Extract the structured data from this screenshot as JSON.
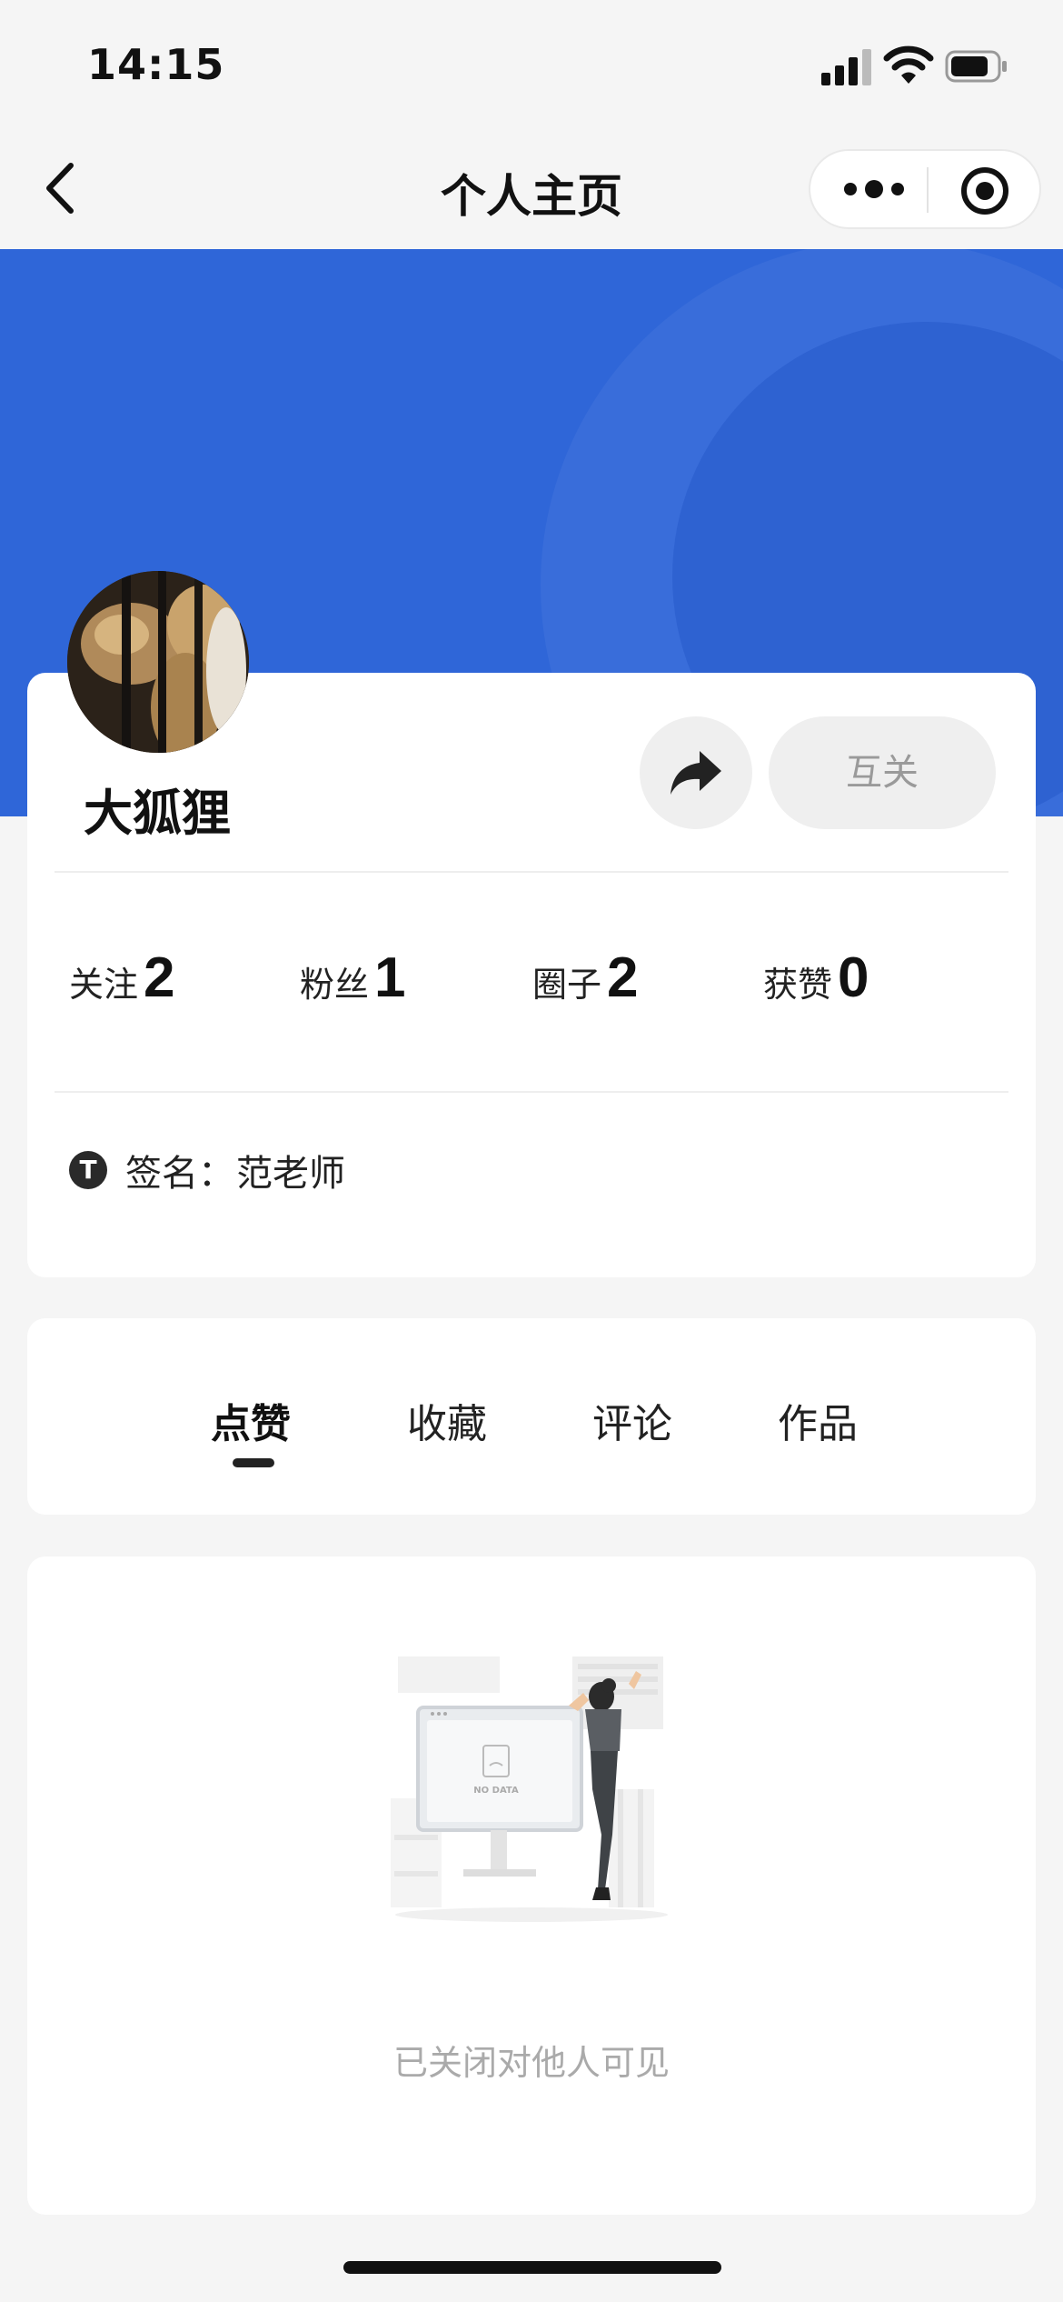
{
  "status_bar": {
    "time": "14:15"
  },
  "nav": {
    "title": "个人主页"
  },
  "profile": {
    "username": "大狐狸",
    "mutual_label": "互关",
    "stats": [
      {
        "label": "关注",
        "value": "2"
      },
      {
        "label": "粉丝",
        "value": "1"
      },
      {
        "label": "圈子",
        "value": "2"
      },
      {
        "label": "获赞",
        "value": "0"
      }
    ],
    "signature": {
      "icon_letter": "T",
      "label": "签名：",
      "value": "范老师"
    }
  },
  "tabs": [
    {
      "label": "点赞",
      "active": true
    },
    {
      "label": "收藏",
      "active": false
    },
    {
      "label": "评论",
      "active": false
    },
    {
      "label": "作品",
      "active": false
    }
  ],
  "empty_state": {
    "illustration_text": "NO DATA",
    "message": "已关闭对他人可见"
  },
  "colors": {
    "banner": "#2f66d8",
    "background": "#f5f5f5"
  }
}
